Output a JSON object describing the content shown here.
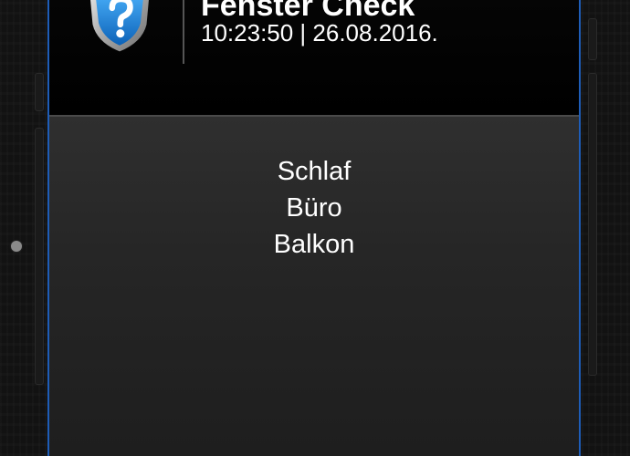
{
  "header": {
    "title": "Fenster Check",
    "datetime": "10:23:50 | 26.08.2016.",
    "logo_icon": "shield-question-icon"
  },
  "rooms": [
    {
      "label": "Schlaf"
    },
    {
      "label": "Büro"
    },
    {
      "label": "Balkon"
    }
  ],
  "colors": {
    "screen_border": "#1e5db8",
    "shield_blue": "#1a8fe0",
    "content_background": "#262626",
    "header_background": "#000000",
    "text": "#ffffff"
  }
}
